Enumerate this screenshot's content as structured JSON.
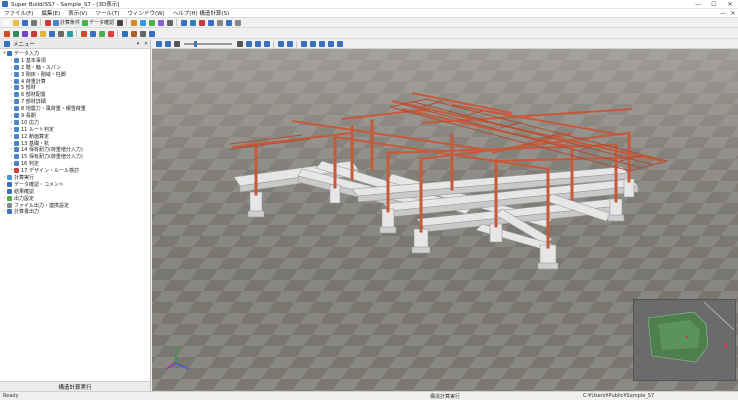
{
  "window": {
    "title": "Super Build/SS7 - Sample_S7 - [3D表示]",
    "minimize": "—",
    "maximize": "☐",
    "close": "✕"
  },
  "menu": {
    "items": [
      "ファイル(F)",
      "編集(E)",
      "表示(V)",
      "ツール(T)",
      "ウィンドウ(W)",
      "ヘルプ(H)  構造計算(S)"
    ]
  },
  "toolbar1": {
    "items": [
      {
        "name": "new-file-icon",
        "color": "#ffffff"
      },
      {
        "name": "open-folder-icon",
        "color": "#e8c049"
      },
      {
        "name": "save-icon",
        "color": "#3a6fbf"
      },
      {
        "name": "print-icon",
        "color": "#777777"
      },
      {
        "name": "calc-run-icon",
        "color": "#c83b3b"
      },
      {
        "name": "calc-settings-icon",
        "color": "#4b86c8",
        "label": "計算条件"
      },
      {
        "name": "data-check-icon",
        "color": "#4caf50",
        "label": "データ確認"
      },
      {
        "name": "stop-icon",
        "color": "#444444"
      },
      {
        "name": "pen-icon",
        "color": "#d28a2a"
      },
      {
        "name": "table-icon",
        "color": "#3a9ad9"
      },
      {
        "name": "chart-icon",
        "color": "#4caf50"
      },
      {
        "name": "list-icon",
        "color": "#8a5fd0"
      },
      {
        "name": "print-preview-icon",
        "color": "#666666"
      },
      {
        "name": "undo-icon",
        "color": "#3a6fbf"
      },
      {
        "name": "grid-view-icon",
        "color": "#2c7fb8"
      },
      {
        "name": "layout-icon",
        "color": "#c83b3b"
      },
      {
        "name": "home-icon",
        "color": "#3a6fbf"
      },
      {
        "name": "tile-icon",
        "color": "#888888"
      },
      {
        "name": "window-icon",
        "color": "#3a6fbf"
      },
      {
        "name": "cascade-icon",
        "color": "#888888"
      }
    ]
  },
  "toolbar2": {
    "items": [
      {
        "name": "frame-icon",
        "color": "#d24a2a"
      },
      {
        "name": "beam-icon",
        "color": "#2e8b57"
      },
      {
        "name": "column-icon",
        "color": "#7a3fd0"
      },
      {
        "name": "wall-icon",
        "color": "#c83b3b"
      },
      {
        "name": "slab-icon",
        "color": "#e7b23a"
      },
      {
        "name": "foundation-icon",
        "color": "#3a6fbf"
      },
      {
        "name": "brace-icon",
        "color": "#6a6a6a"
      },
      {
        "name": "pile-icon",
        "color": "#2aa1a1"
      },
      {
        "name": "load-icon",
        "color": "#d24a2a"
      },
      {
        "name": "section-icon",
        "color": "#3a6fbf"
      },
      {
        "name": "layer-icon",
        "color": "#4caf50"
      },
      {
        "name": "node-icon",
        "color": "#e04040"
      },
      {
        "name": "member-icon",
        "color": "#3070c0"
      },
      {
        "name": "ground-icon",
        "color": "#b05a2a"
      },
      {
        "name": "zoom-icon",
        "color": "#666666"
      },
      {
        "name": "fit-icon",
        "color": "#3a6fbf"
      }
    ]
  },
  "panel": {
    "title": "メニュー",
    "tree": [
      {
        "level": 0,
        "expander": "▾",
        "color": "#3a6fbf",
        "label": "データ入力"
      },
      {
        "level": 1,
        "expander": "›",
        "color": "#4b86c8",
        "label": "1 基本事項"
      },
      {
        "level": 1,
        "expander": "›",
        "color": "#4b86c8",
        "label": "2 階・軸・スパン"
      },
      {
        "level": 1,
        "expander": "›",
        "color": "#4b86c8",
        "label": "3 剛床・剛域・柱脚"
      },
      {
        "level": 1,
        "expander": "›",
        "color": "#4b86c8",
        "label": "4 荷重計算"
      },
      {
        "level": 1,
        "expander": "›",
        "color": "#4b86c8",
        "label": "5 部材"
      },
      {
        "level": 1,
        "expander": "›",
        "color": "#4b86c8",
        "label": "6 部材配置"
      },
      {
        "level": 1,
        "expander": "›",
        "color": "#4b86c8",
        "label": "7 部材詳細"
      },
      {
        "level": 1,
        "expander": "›",
        "color": "#4b86c8",
        "label": "8 地震力・風荷重・積雪荷重"
      },
      {
        "level": 1,
        "expander": "›",
        "color": "#4b86c8",
        "label": "9 長期"
      },
      {
        "level": 1,
        "expander": "›",
        "color": "#4b86c8",
        "label": "10 応力"
      },
      {
        "level": 1,
        "expander": "›",
        "color": "#4b86c8",
        "label": "11 ルート判定"
      },
      {
        "level": 1,
        "expander": "›",
        "color": "#4b86c8",
        "label": "12 断面算定"
      },
      {
        "level": 1,
        "expander": "›",
        "color": "#4b86c8",
        "label": "13 基礎・杭"
      },
      {
        "level": 1,
        "expander": "›",
        "color": "#4b86c8",
        "label": "14 保有耐力(荷重増分入力)"
      },
      {
        "level": 1,
        "expander": "›",
        "color": "#4b86c8",
        "label": "15 保有耐力(荷重増分入力)"
      },
      {
        "level": 1,
        "expander": "›",
        "color": "#4b86c8",
        "label": "16 判定"
      },
      {
        "level": 1,
        "expander": "›",
        "color": "#d04040",
        "label": "17 デザイン・ルール検討"
      },
      {
        "level": 0,
        "expander": "›",
        "color": "#3a9ad9",
        "label": "計算実行"
      },
      {
        "level": 0,
        "expander": "›",
        "color": "#3a6fbf",
        "label": "データ確認・コメント"
      },
      {
        "level": 0,
        "expander": "›",
        "color": "#3a6fbf",
        "label": "結果確認"
      },
      {
        "level": 0,
        "expander": "›",
        "color": "#4caf50",
        "label": "出力設定"
      },
      {
        "level": 0,
        "expander": "›",
        "color": "#888888",
        "label": "ファイル出力・連携設定"
      },
      {
        "level": 0,
        "expander": "›",
        "color": "#3a6fbf",
        "label": "計算書出力"
      }
    ],
    "footer": "構造計算実行"
  },
  "viewbar": {
    "items": [
      {
        "name": "view-select-icon",
        "color": "#3a6fbf"
      },
      {
        "name": "view-rotate-icon",
        "color": "#3a6fbf"
      },
      {
        "name": "zoom-icon",
        "color": "#555555"
      }
    ],
    "items_after": [
      {
        "name": "view-front-icon",
        "color": "#555555"
      },
      {
        "name": "view-top-icon",
        "color": "#3a6fbf"
      },
      {
        "name": "view-side-icon",
        "color": "#3a6fbf"
      },
      {
        "name": "view-iso-icon",
        "color": "#3a6fbf"
      },
      {
        "name": "solid-icon",
        "color": "#3a6fbf"
      },
      {
        "name": "wire-icon",
        "color": "#3a6fbf"
      },
      {
        "name": "axis-toggle-icon",
        "color": "#3a6fbf"
      },
      {
        "name": "node-toggle-icon",
        "color": "#3a6fbf"
      },
      {
        "name": "member-toggle-icon",
        "color": "#3a6fbf"
      },
      {
        "name": "filter-icon",
        "color": "#3a6fbf"
      },
      {
        "name": "settings-icon",
        "color": "#3a6fbf"
      }
    ],
    "zoom_level": 0.22
  },
  "status": {
    "left": "Ready",
    "center": "構造計算実行",
    "right": "C:¥Users¥Public¥Sample_S7"
  },
  "colors": {
    "steel": "#c65a3a",
    "concrete": "#e8e8e8",
    "floor_light": "#8c8a84",
    "floor_dark": "#7b7972"
  }
}
